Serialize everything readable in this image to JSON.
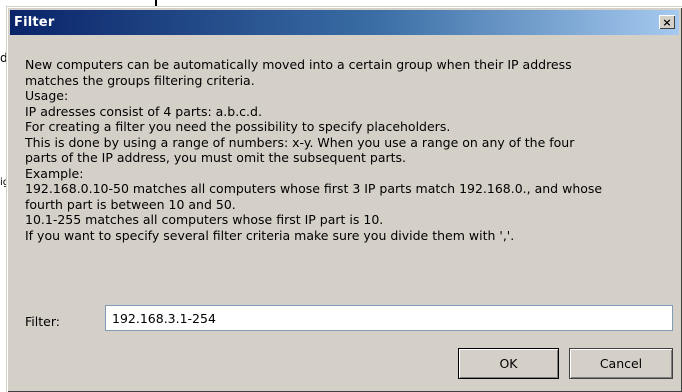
{
  "background": {
    "fragments": [
      "d",
      "ig"
    ]
  },
  "dialog": {
    "title": "Filter",
    "close_label": "×",
    "description_lines": [
      "New computers can be automatically moved into a certain group when their IP address",
      "matches the groups filtering criteria.",
      "Usage:",
      "IP adresses consist of 4 parts: a.b.c.d.",
      "For creating a filter you need the possibility to specify placeholders.",
      "This is done by using a range of numbers: x-y. When you use a range on any of the four",
      "parts of the IP address, you must omit the subsequent parts.",
      "Example:",
      "192.168.0.10-50 matches all computers whose first 3 IP parts match 192.168.0., and whose",
      "fourth part is between 10 and 50.",
      "10.1-255 matches all computers whose first IP part is 10.",
      "If you want to specify several filter criteria make sure you divide them with ','."
    ],
    "filter_label": "Filter:",
    "filter_value": "192.168.3.1-254",
    "ok_label": "OK",
    "cancel_label": "Cancel"
  },
  "colors": {
    "titlebar_start": "#0a246a",
    "titlebar_end": "#a6caf0",
    "dialog_bg": "#d4d0c8"
  }
}
